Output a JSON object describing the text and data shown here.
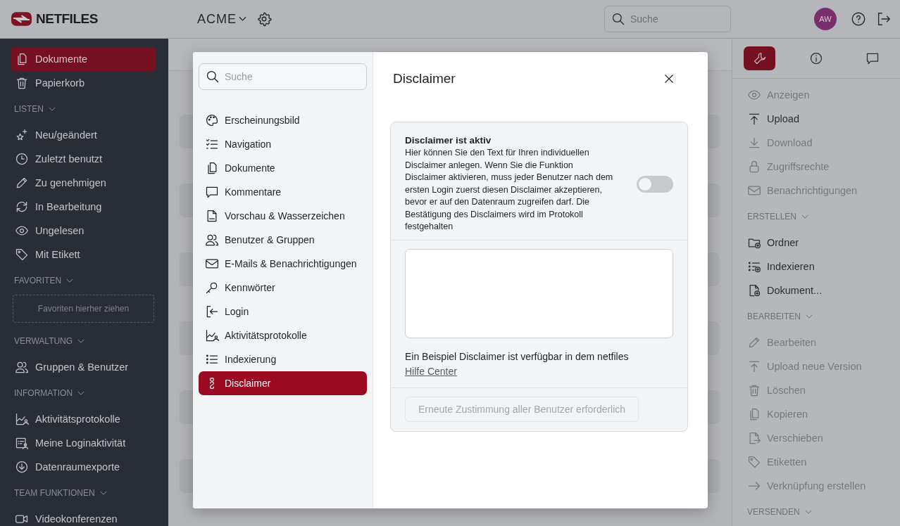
{
  "topbar": {
    "logo": "NETFILES",
    "workspace": "ACME",
    "search": {
      "placeholder": "Suche"
    },
    "avatar": "AW"
  },
  "sidebar": {
    "items": [
      {
        "label": "Dokumente",
        "selected": true
      },
      {
        "label": "Papierkorb",
        "selected": false
      }
    ],
    "sections": [
      {
        "title": "LISTEN",
        "items": [
          {
            "label": "Neu/geändert",
            "selected": false
          },
          {
            "label": "Zuletzt benutzt",
            "selected": false
          },
          {
            "label": "Zu genehmigen",
            "selected": false
          },
          {
            "label": "In Bearbeitung",
            "selected": false
          },
          {
            "label": "Ungelesen",
            "selected": false
          },
          {
            "label": "Mit Etikett",
            "selected": false
          }
        ]
      },
      {
        "title": "FAVORITEN",
        "dropzone": "Favoriten hierher ziehen"
      },
      {
        "title": "VERWALTUNG",
        "items": [
          {
            "label": "Gruppen & Benutzer",
            "selected": false
          }
        ]
      },
      {
        "title": "INFORMATION",
        "items": [
          {
            "label": "Aktivitätsprotokolle",
            "selected": false
          },
          {
            "label": "Meine Loginaktivität",
            "selected": false
          },
          {
            "label": "Datenraumexporte",
            "selected": false
          }
        ]
      },
      {
        "title": "TEAM FUNKTIONEN",
        "items": [
          {
            "label": "Videokonferenzen",
            "selected": false
          }
        ]
      }
    ]
  },
  "right_panel": {
    "tabs": [
      {
        "selected": true
      },
      {
        "selected": false
      },
      {
        "selected": false
      }
    ],
    "items": [
      {
        "label": "Anzeigen",
        "disabled": true
      },
      {
        "label": "Upload",
        "disabled": false
      },
      {
        "label": "Download",
        "disabled": true
      },
      {
        "label": "Zugriffsrechte",
        "disabled": true
      },
      {
        "label": "Benachrichtigungen",
        "disabled": true
      }
    ],
    "sections": [
      {
        "title": "ERSTELLEN",
        "items": [
          {
            "label": "Ordner",
            "disabled": false
          },
          {
            "label": "Indexieren",
            "disabled": false
          },
          {
            "label": "Dokument...",
            "disabled": false
          }
        ]
      },
      {
        "title": "BEARBEITEN",
        "items": [
          {
            "label": "Bearbeiten",
            "disabled": true
          },
          {
            "label": "Upload neue Version",
            "disabled": true
          },
          {
            "label": "Löschen",
            "disabled": true
          },
          {
            "label": "Kopieren",
            "disabled": true
          },
          {
            "label": "Verschieben",
            "disabled": true
          },
          {
            "label": "Etiketten",
            "disabled": true
          },
          {
            "label": "Verknüpfung erstellen",
            "disabled": true
          }
        ]
      },
      {
        "title": "VERSENDEN"
      }
    ]
  },
  "dialog": {
    "search": {
      "placeholder": "Suche"
    },
    "nav": [
      {
        "label": "Erscheinungsbild",
        "selected": false
      },
      {
        "label": "Navigation",
        "selected": false
      },
      {
        "label": "Dokumente",
        "selected": false
      },
      {
        "label": "Kommentare",
        "selected": false
      },
      {
        "label": "Vorschau & Wasserzeichen",
        "selected": false
      },
      {
        "label": "Benutzer & Gruppen",
        "selected": false
      },
      {
        "label": "E-Mails & Benachrichtigungen",
        "selected": false
      },
      {
        "label": "Kennwörter",
        "selected": false
      },
      {
        "label": "Login",
        "selected": false
      },
      {
        "label": "Aktivitätsprotokolle",
        "selected": false
      },
      {
        "label": "Indexierung",
        "selected": false
      },
      {
        "label": "Disclaimer",
        "selected": true
      }
    ],
    "title": "Disclaimer",
    "setting": {
      "label": "Disclaimer ist aktiv",
      "description": "Hier können Sie den Text für Ihren individuellen Disclaimer anlegen. Wenn Sie die Funktion Disclaimer aktivieren, muss jeder Benutzer nach dem ersten Login zuerst diesen Disclaimer akzeptieren, bevor er auf den Datenraum zugreifen darf. Die Bestätigung des Disclaimers wird im Protokoll festgehalten",
      "on": false
    },
    "hint": "Ein Beispiel Disclaimer ist verfügbar in dem netfiles",
    "hint_link": "Hilfe Center",
    "button": {
      "label": "Erneute Zustimmung aller Benutzer erforderlich",
      "disabled": true
    }
  }
}
